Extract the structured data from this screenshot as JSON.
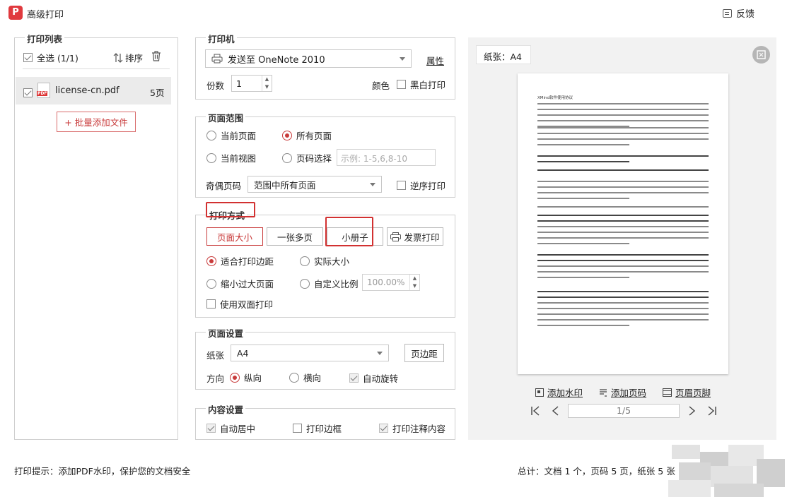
{
  "window": {
    "title": "高级打印",
    "logo": "P",
    "feedback": "反馈"
  },
  "print_list": {
    "section_label": "打印列表",
    "select_all": "全选 (1/1)",
    "sort": "排序",
    "file_badge": "PDF",
    "file_name": "license-cn.pdf",
    "file_pages": "5页",
    "add_files": "+ 批量添加文件"
  },
  "printer": {
    "section_label": "打印机",
    "name": "发送至 OneNote 2010",
    "properties": "属性",
    "copies_label": "份数",
    "copies_value": "1",
    "color_label": "颜色",
    "bw_label": "黑白打印"
  },
  "page_range": {
    "section_label": "页面范围",
    "current_page": "当前页面",
    "all_pages": "所有页面",
    "current_view": "当前视图",
    "page_select": "页码选择",
    "page_select_placeholder": "示例: 1-5,6,8-10",
    "odd_even_label": "奇偶页码",
    "odd_even_value": "范围中所有页面",
    "reverse_label": "逆序打印"
  },
  "print_mode": {
    "section_label": "打印方式",
    "tabs": [
      "页面大小",
      "一张多页",
      "小册子",
      "发票打印"
    ],
    "fit_margins": "适合打印边距",
    "actual_size": "实际大小",
    "shrink_large": "缩小过大页面",
    "custom_scale": "自定义比例",
    "scale_value": "100.00%",
    "duplex": "使用双面打印"
  },
  "page_setup": {
    "section_label": "页面设置",
    "paper_label": "纸张",
    "paper_value": "A4",
    "margins_button": "页边距",
    "orientation_label": "方向",
    "portrait": "纵向",
    "landscape": "横向",
    "auto_rotate": "自动旋转"
  },
  "content_setup": {
    "section_label": "内容设置",
    "auto_center": "自动居中",
    "print_border": "打印边框",
    "print_annotations": "打印注释内容"
  },
  "preview": {
    "paper_label": "纸张：A4",
    "doc_title": "XMind软件使用协议",
    "add_watermark": "添加水印",
    "add_page_number": "添加页码",
    "header_footer": "页眉页脚",
    "page_indicator": "1/5"
  },
  "footer": {
    "tip": "打印提示：添加PDF水印，保护您的文档安全",
    "summary": "总计：文档 1 个，页码 5 页，纸张 5 张"
  },
  "colors": {
    "accent": "#c83a3a",
    "highlight_box": "#d23131",
    "logo_bg": "#e0393e"
  },
  "icons": [
    "printer-icon",
    "sort-icon",
    "trash-icon",
    "pdf-file-icon",
    "invoice-printer-icon",
    "fullscreen-icon",
    "watermark-icon",
    "page-number-icon",
    "header-footer-icon",
    "first-page-icon",
    "prev-page-icon",
    "next-page-icon",
    "last-page-icon",
    "feedback-icon"
  ]
}
